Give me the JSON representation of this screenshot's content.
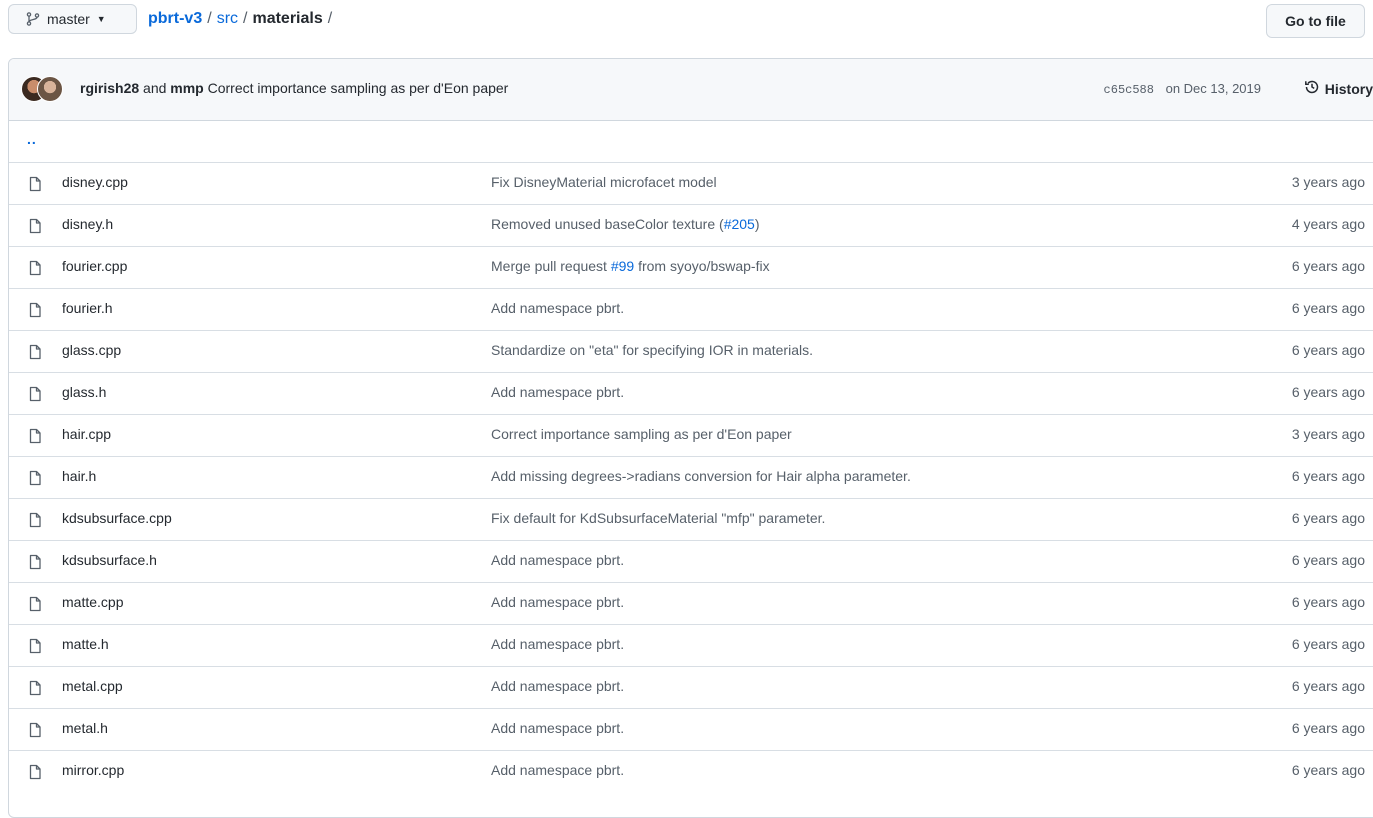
{
  "header": {
    "branch": "master",
    "repo": "pbrt-v3",
    "sep1": "/",
    "dir": "src",
    "sep2": "/",
    "current": "materials",
    "sep3": "/",
    "goto_label": "Go to file"
  },
  "commit": {
    "author1": "rgirish28",
    "and": "and",
    "author2": "mmp",
    "message": "Correct importance sampling as per d'Eon paper",
    "sha": "c65c588",
    "date": "on Dec 13, 2019",
    "history_label": "History"
  },
  "parent_link": "..",
  "files": [
    {
      "name": "disney.cpp",
      "msg_before": "Fix DisneyMaterial microfacet model",
      "issue": "",
      "msg_after": "",
      "age": "3 years ago"
    },
    {
      "name": "disney.h",
      "msg_before": "Removed unused baseColor texture (",
      "issue": "#205",
      "msg_after": ")",
      "age": "4 years ago"
    },
    {
      "name": "fourier.cpp",
      "msg_before": "Merge pull request ",
      "issue": "#99",
      "msg_after": " from syoyo/bswap-fix",
      "age": "6 years ago"
    },
    {
      "name": "fourier.h",
      "msg_before": "Add namespace pbrt.",
      "issue": "",
      "msg_after": "",
      "age": "6 years ago"
    },
    {
      "name": "glass.cpp",
      "msg_before": "Standardize on \"eta\" for specifying IOR in materials.",
      "issue": "",
      "msg_after": "",
      "age": "6 years ago"
    },
    {
      "name": "glass.h",
      "msg_before": "Add namespace pbrt.",
      "issue": "",
      "msg_after": "",
      "age": "6 years ago"
    },
    {
      "name": "hair.cpp",
      "msg_before": "Correct importance sampling as per d'Eon paper",
      "issue": "",
      "msg_after": "",
      "age": "3 years ago"
    },
    {
      "name": "hair.h",
      "msg_before": "Add missing degrees->radians conversion for Hair alpha parameter.",
      "issue": "",
      "msg_after": "",
      "age": "6 years ago"
    },
    {
      "name": "kdsubsurface.cpp",
      "msg_before": "Fix default for KdSubsurfaceMaterial \"mfp\" parameter.",
      "issue": "",
      "msg_after": "",
      "age": "6 years ago"
    },
    {
      "name": "kdsubsurface.h",
      "msg_before": "Add namespace pbrt.",
      "issue": "",
      "msg_after": "",
      "age": "6 years ago"
    },
    {
      "name": "matte.cpp",
      "msg_before": "Add namespace pbrt.",
      "issue": "",
      "msg_after": "",
      "age": "6 years ago"
    },
    {
      "name": "matte.h",
      "msg_before": "Add namespace pbrt.",
      "issue": "",
      "msg_after": "",
      "age": "6 years ago"
    },
    {
      "name": "metal.cpp",
      "msg_before": "Add namespace pbrt.",
      "issue": "",
      "msg_after": "",
      "age": "6 years ago"
    },
    {
      "name": "metal.h",
      "msg_before": "Add namespace pbrt.",
      "issue": "",
      "msg_after": "",
      "age": "6 years ago"
    },
    {
      "name": "mirror.cpp",
      "msg_before": "Add namespace pbrt.",
      "issue": "",
      "msg_after": "",
      "age": "6 years ago"
    }
  ],
  "icons": {
    "branch": "git-branch-icon",
    "file": "file-icon",
    "history": "history-icon",
    "caret": "caret-down-icon"
  },
  "colors": {
    "link": "#0969da",
    "text": "#24292f",
    "muted": "#57606a",
    "border": "#d0d7de",
    "header_bg": "#f6f8fa"
  }
}
